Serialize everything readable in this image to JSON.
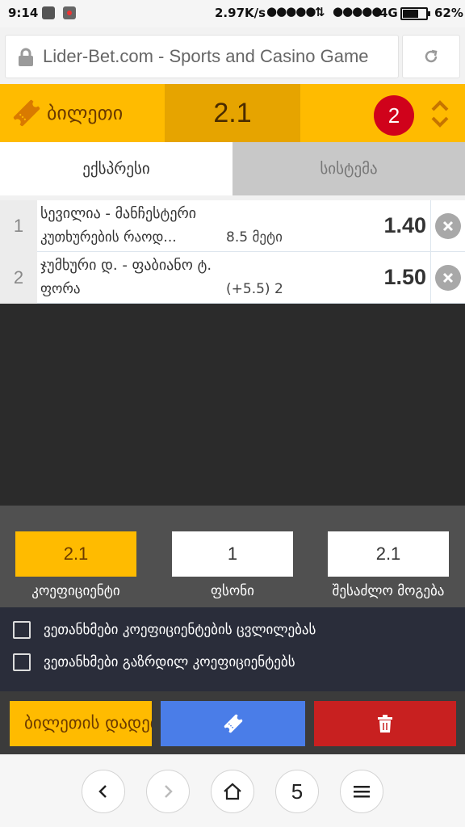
{
  "status_bar": {
    "time": "9:14",
    "speed": "2.97K/s",
    "signal1": "●●●●●",
    "signal2": "●●●●●",
    "network": "4G",
    "battery": "62%"
  },
  "browser": {
    "url": "Lider-Bet.com - Sports and Casino Game",
    "reload_icon": "reload-icon"
  },
  "ticket": {
    "title": "ბილეთი",
    "total_odds": "2.1",
    "count": "2"
  },
  "tabs": {
    "express": "ექსპრესი",
    "system": "სისტემა",
    "active": "express"
  },
  "bets": [
    {
      "index": "1",
      "match": "სევილია - მანჩესტერი",
      "market": "კუთხურების რაოდ...",
      "pick": "8.5 მეტი",
      "odd": "1.40"
    },
    {
      "index": "2",
      "match": "ჯუმხური დ. - ფაბიანო ტ.",
      "market": "ფორა",
      "pick": "(+5.5) 2",
      "odd": "1.50"
    }
  ],
  "summary": {
    "coefficient_value": "2.1",
    "coefficient_label": "კოეფიციენტი",
    "stake_value": "1",
    "stake_label": "ფსონი",
    "win_value": "2.1",
    "win_label": "შესაძლო მოგება"
  },
  "agreements": {
    "accept_changes": "ვეთანხმები კოეფიციენტების ცვლილებას",
    "accept_increased": "ვეთანხმები გაზრდილ კოეფიციენტებს"
  },
  "actions": {
    "save_label": "ბილეთის დადება"
  },
  "browser_nav": {
    "tabs_count": "5"
  },
  "colors": {
    "accent": "#ffbb00",
    "blue": "#4a7de8",
    "red": "#c82020",
    "badge": "#d0021b"
  }
}
